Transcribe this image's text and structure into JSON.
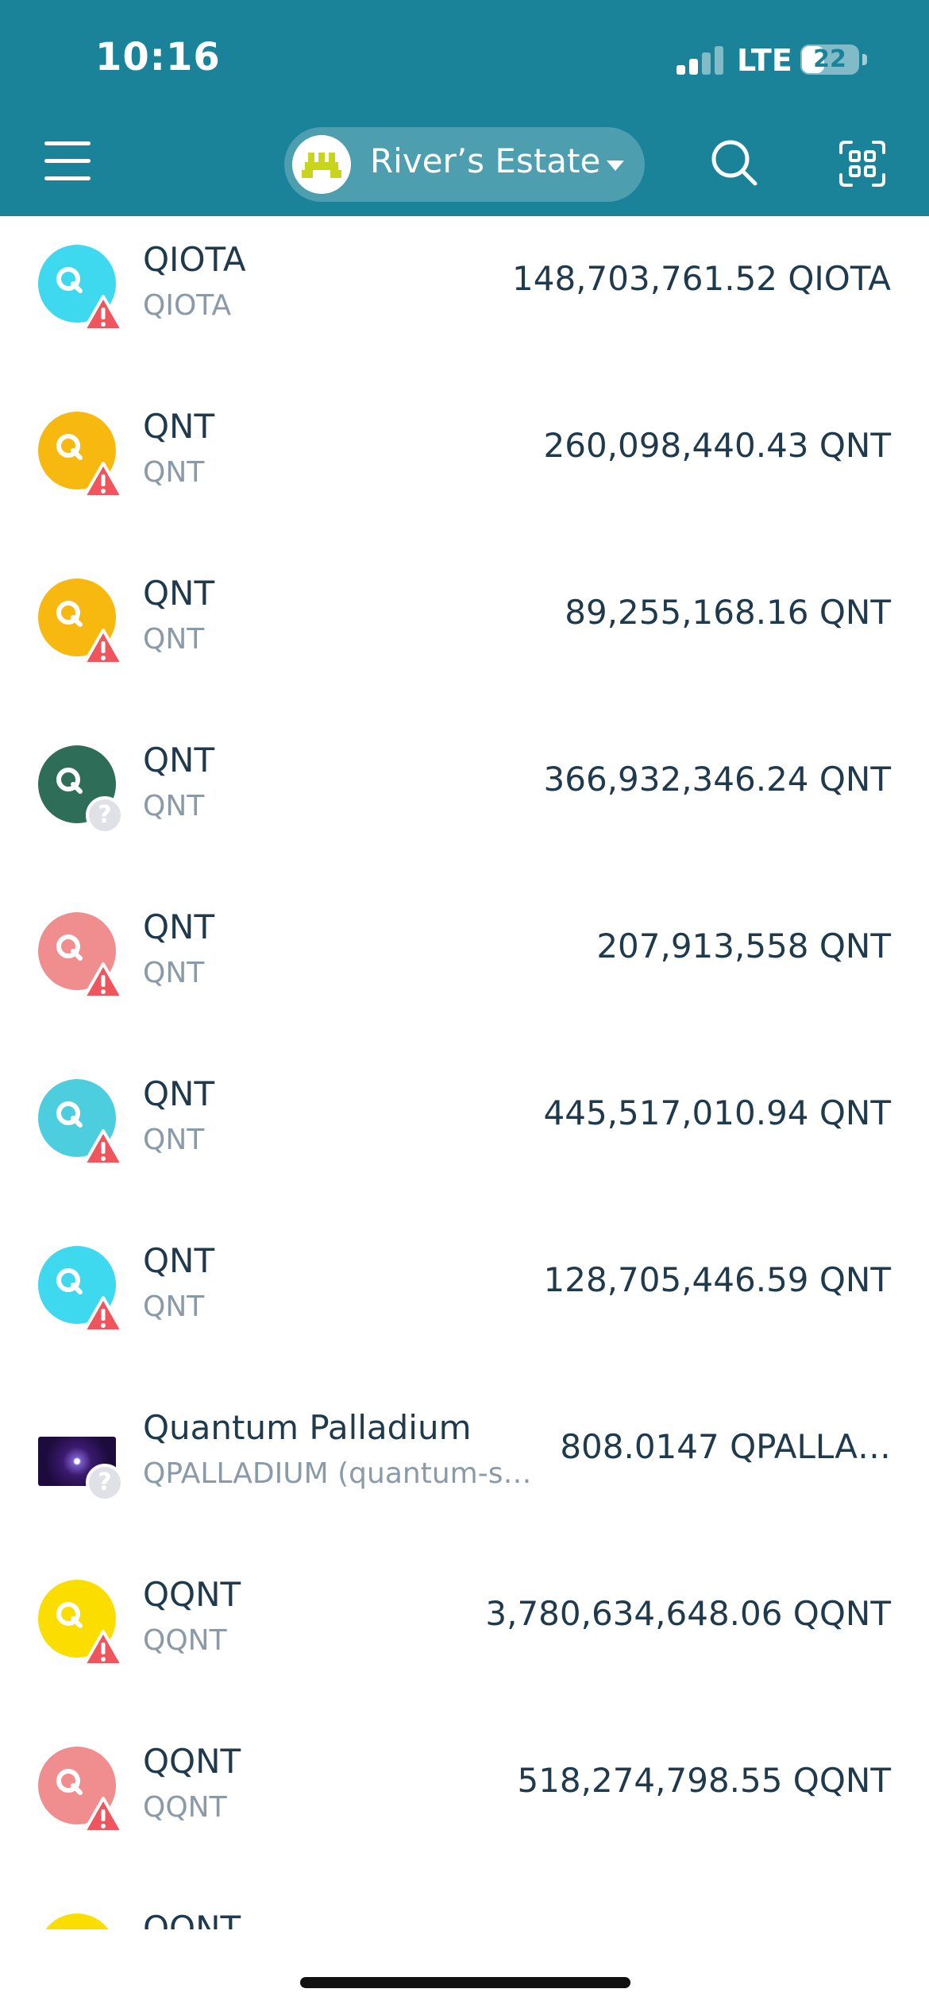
{
  "status_bar": {
    "time": "10:16",
    "network": "LTE",
    "battery": "22"
  },
  "header": {
    "wallet_name": "River’s Estate",
    "icons": [
      "hamburger-menu-icon",
      "wallet-avatar-icon",
      "chevron-down-icon",
      "search-icon",
      "qr-scan-icon"
    ],
    "accent": "#1b8399"
  },
  "tokens": [
    {
      "name": "QIOTA",
      "symbol": "QIOTA",
      "balance": "148,703,761.52 QIOTA",
      "color": "#3ed8ef",
      "badge": "warning"
    },
    {
      "name": "QNT",
      "symbol": "QNT",
      "balance": "260,098,440.43 QNT",
      "color": "#f7b80f",
      "badge": "warning"
    },
    {
      "name": "QNT",
      "symbol": "QNT",
      "balance": "89,255,168.16 QNT",
      "color": "#f7b80f",
      "badge": "warning"
    },
    {
      "name": "QNT",
      "symbol": "QNT",
      "balance": "366,932,346.24 QNT",
      "color": "#2e6e58",
      "badge": "unknown"
    },
    {
      "name": "QNT",
      "symbol": "QNT",
      "balance": "207,913,558 QNT",
      "color": "#f08d8e",
      "badge": "warning"
    },
    {
      "name": "QNT",
      "symbol": "QNT",
      "balance": "445,517,010.94 QNT",
      "color": "#4dcede",
      "badge": "warning"
    },
    {
      "name": "QNT",
      "symbol": "QNT",
      "balance": "128,705,446.59 QNT",
      "color": "#3ed8ef",
      "badge": "warning"
    },
    {
      "name": "Quantum Palladium",
      "symbol": "QPALLADIUM (quantum-s…",
      "balance": "808.0147 QPALLA…",
      "color": "#2a1456",
      "badge": "unknown",
      "image_icon": true
    },
    {
      "name": "QQNT",
      "symbol": "QQNT",
      "balance": "3,780,634,648.06 QQNT",
      "color": "#fcdd00",
      "badge": "warning"
    },
    {
      "name": "QQNT",
      "symbol": "QQNT",
      "balance": "518,274,798.55 QQNT",
      "color": "#f08d8e",
      "badge": "warning"
    },
    {
      "name": "QQNT",
      "symbol": "",
      "balance": "",
      "color": "#fcdd00",
      "badge": "none"
    }
  ],
  "badge_colors": {
    "warning": "#f0545c",
    "unknown": "#dfe1e6"
  }
}
